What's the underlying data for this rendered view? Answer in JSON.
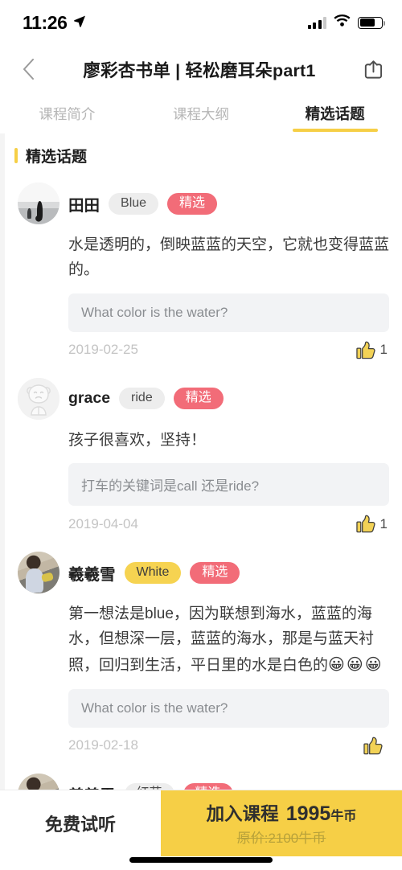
{
  "status_bar": {
    "time": "11:26",
    "location_icon": "location-arrow-icon",
    "signal_icon": "cellular-signal-icon",
    "signal_bars_filled": 3,
    "signal_bars_total": 4,
    "wifi_icon": "wifi-icon",
    "battery_icon": "battery-icon",
    "battery_level_percent": 70
  },
  "navbar": {
    "back_icon": "chevron-left-icon",
    "title": "廖彩杏书单 | 轻松磨耳朵part1",
    "share_icon": "share-icon"
  },
  "tabs": [
    {
      "label": "课程简介",
      "active": false
    },
    {
      "label": "课程大纲",
      "active": false
    },
    {
      "label": "精选话题",
      "active": true
    }
  ],
  "section": {
    "title": "精选话题",
    "accent_color": "#F6CF46"
  },
  "colors": {
    "accent_yellow": "#F6CF46",
    "featured_red": "#F26C78",
    "tag_gray": "#EDEDED",
    "tag_yellow": "#F6D351",
    "question_bg": "#F2F3F5",
    "date_gray": "#C4C4C4"
  },
  "comments": [
    {
      "avatar_name": "avatar-tiantian",
      "avatar_style": "photo-gray",
      "name": "田田",
      "tag": "Blue",
      "tag_style": "gray",
      "featured_label": "精选",
      "text": "水是透明的，倒映蓝蓝的天空，它就也变得蓝蓝的。",
      "emojis": "",
      "question": "What color is the water?",
      "date": "2019-02-25",
      "like_icon": "thumbs-up-icon",
      "like_count": "1"
    },
    {
      "avatar_name": "avatar-grace",
      "avatar_style": "line-art",
      "name": "grace",
      "tag": "ride",
      "tag_style": "gray",
      "featured_label": "精选",
      "text": "孩子很喜欢，坚持！",
      "emojis": "",
      "question": "打车的关键词是call 还是ride?",
      "date": "2019-04-04",
      "like_icon": "thumbs-up-icon",
      "like_count": "1"
    },
    {
      "avatar_name": "avatar-xixixue",
      "avatar_style": "photo-kid",
      "name": "羲羲雪",
      "tag": "White",
      "tag_style": "yellow",
      "featured_label": "精选",
      "text": "第一想法是blue，因为联想到海水，蓝蓝的海水，但想深一层，蓝蓝的海水，那是与蓝天衬照，回归到生活，平日里的水是白色的",
      "emojis": "😀😀😀",
      "question": "What color is the water?",
      "date": "2019-02-18",
      "like_icon": "thumbs-up-icon",
      "like_count": ""
    },
    {
      "avatar_name": "avatar-xixixue-2",
      "avatar_style": "photo-kid",
      "name": "羲羲雪",
      "tag": "红花",
      "tag_style": "gray",
      "featured_label": "精选",
      "text": "",
      "emojis": "",
      "question": "",
      "date": "",
      "like_icon": "thumbs-up-icon",
      "like_count": ""
    }
  ],
  "bottom_bar": {
    "trial_label": "免费试听",
    "join_label": "加入课程",
    "join_price": "1995",
    "join_price_unit": "牛币",
    "original_price_label": "原价:2100牛币"
  }
}
